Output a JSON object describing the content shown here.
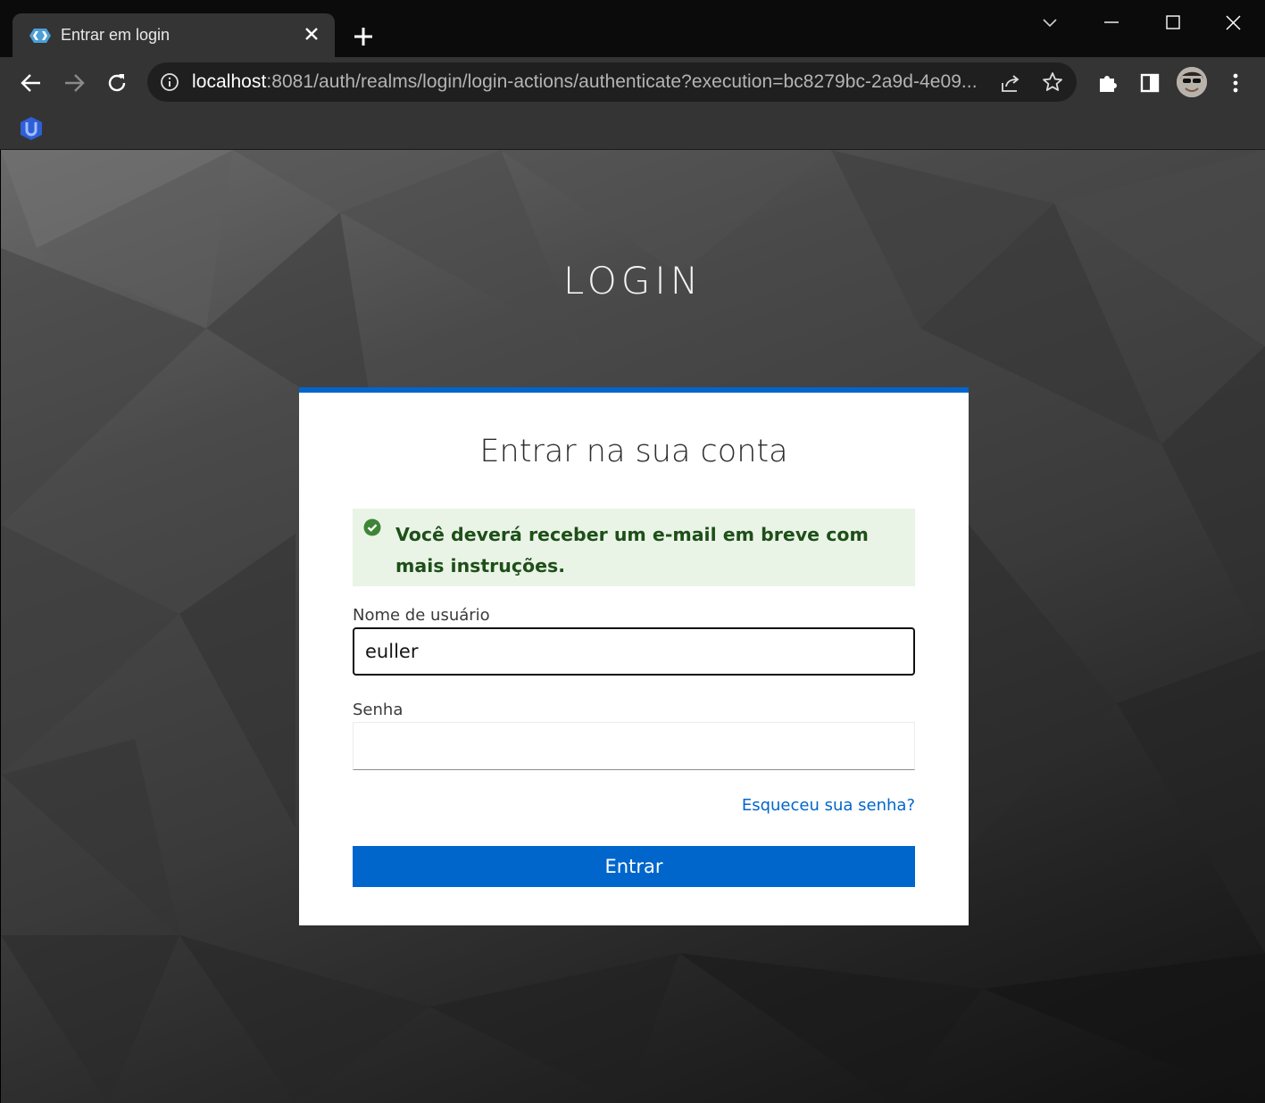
{
  "browser": {
    "tab_title": "Entrar em login",
    "url_host": "localhost",
    "url_rest": ":8081/auth/realms/login/login-actions/authenticate?execution=bc8279bc-2a9d-4e09..."
  },
  "page": {
    "realm_title": "LOGIN",
    "card_title": "Entrar na sua conta",
    "alert": {
      "type": "success",
      "message": "Você deverá receber um e-mail em breve com mais instruções."
    },
    "username": {
      "label": "Nome de usuário",
      "value": "euller"
    },
    "password": {
      "label": "Senha",
      "value": ""
    },
    "forgot_link": "Esqueceu sua senha?",
    "submit_label": "Entrar"
  },
  "colors": {
    "primary": "#0066cc",
    "success_bg": "#e9f4e7",
    "success_text": "#1e4f18",
    "success_icon": "#3e8635"
  },
  "icons": {
    "tab": "keycloak-favicon",
    "bookmark": "keycloak-bookmark-icon",
    "alert": "check-circle-icon"
  }
}
